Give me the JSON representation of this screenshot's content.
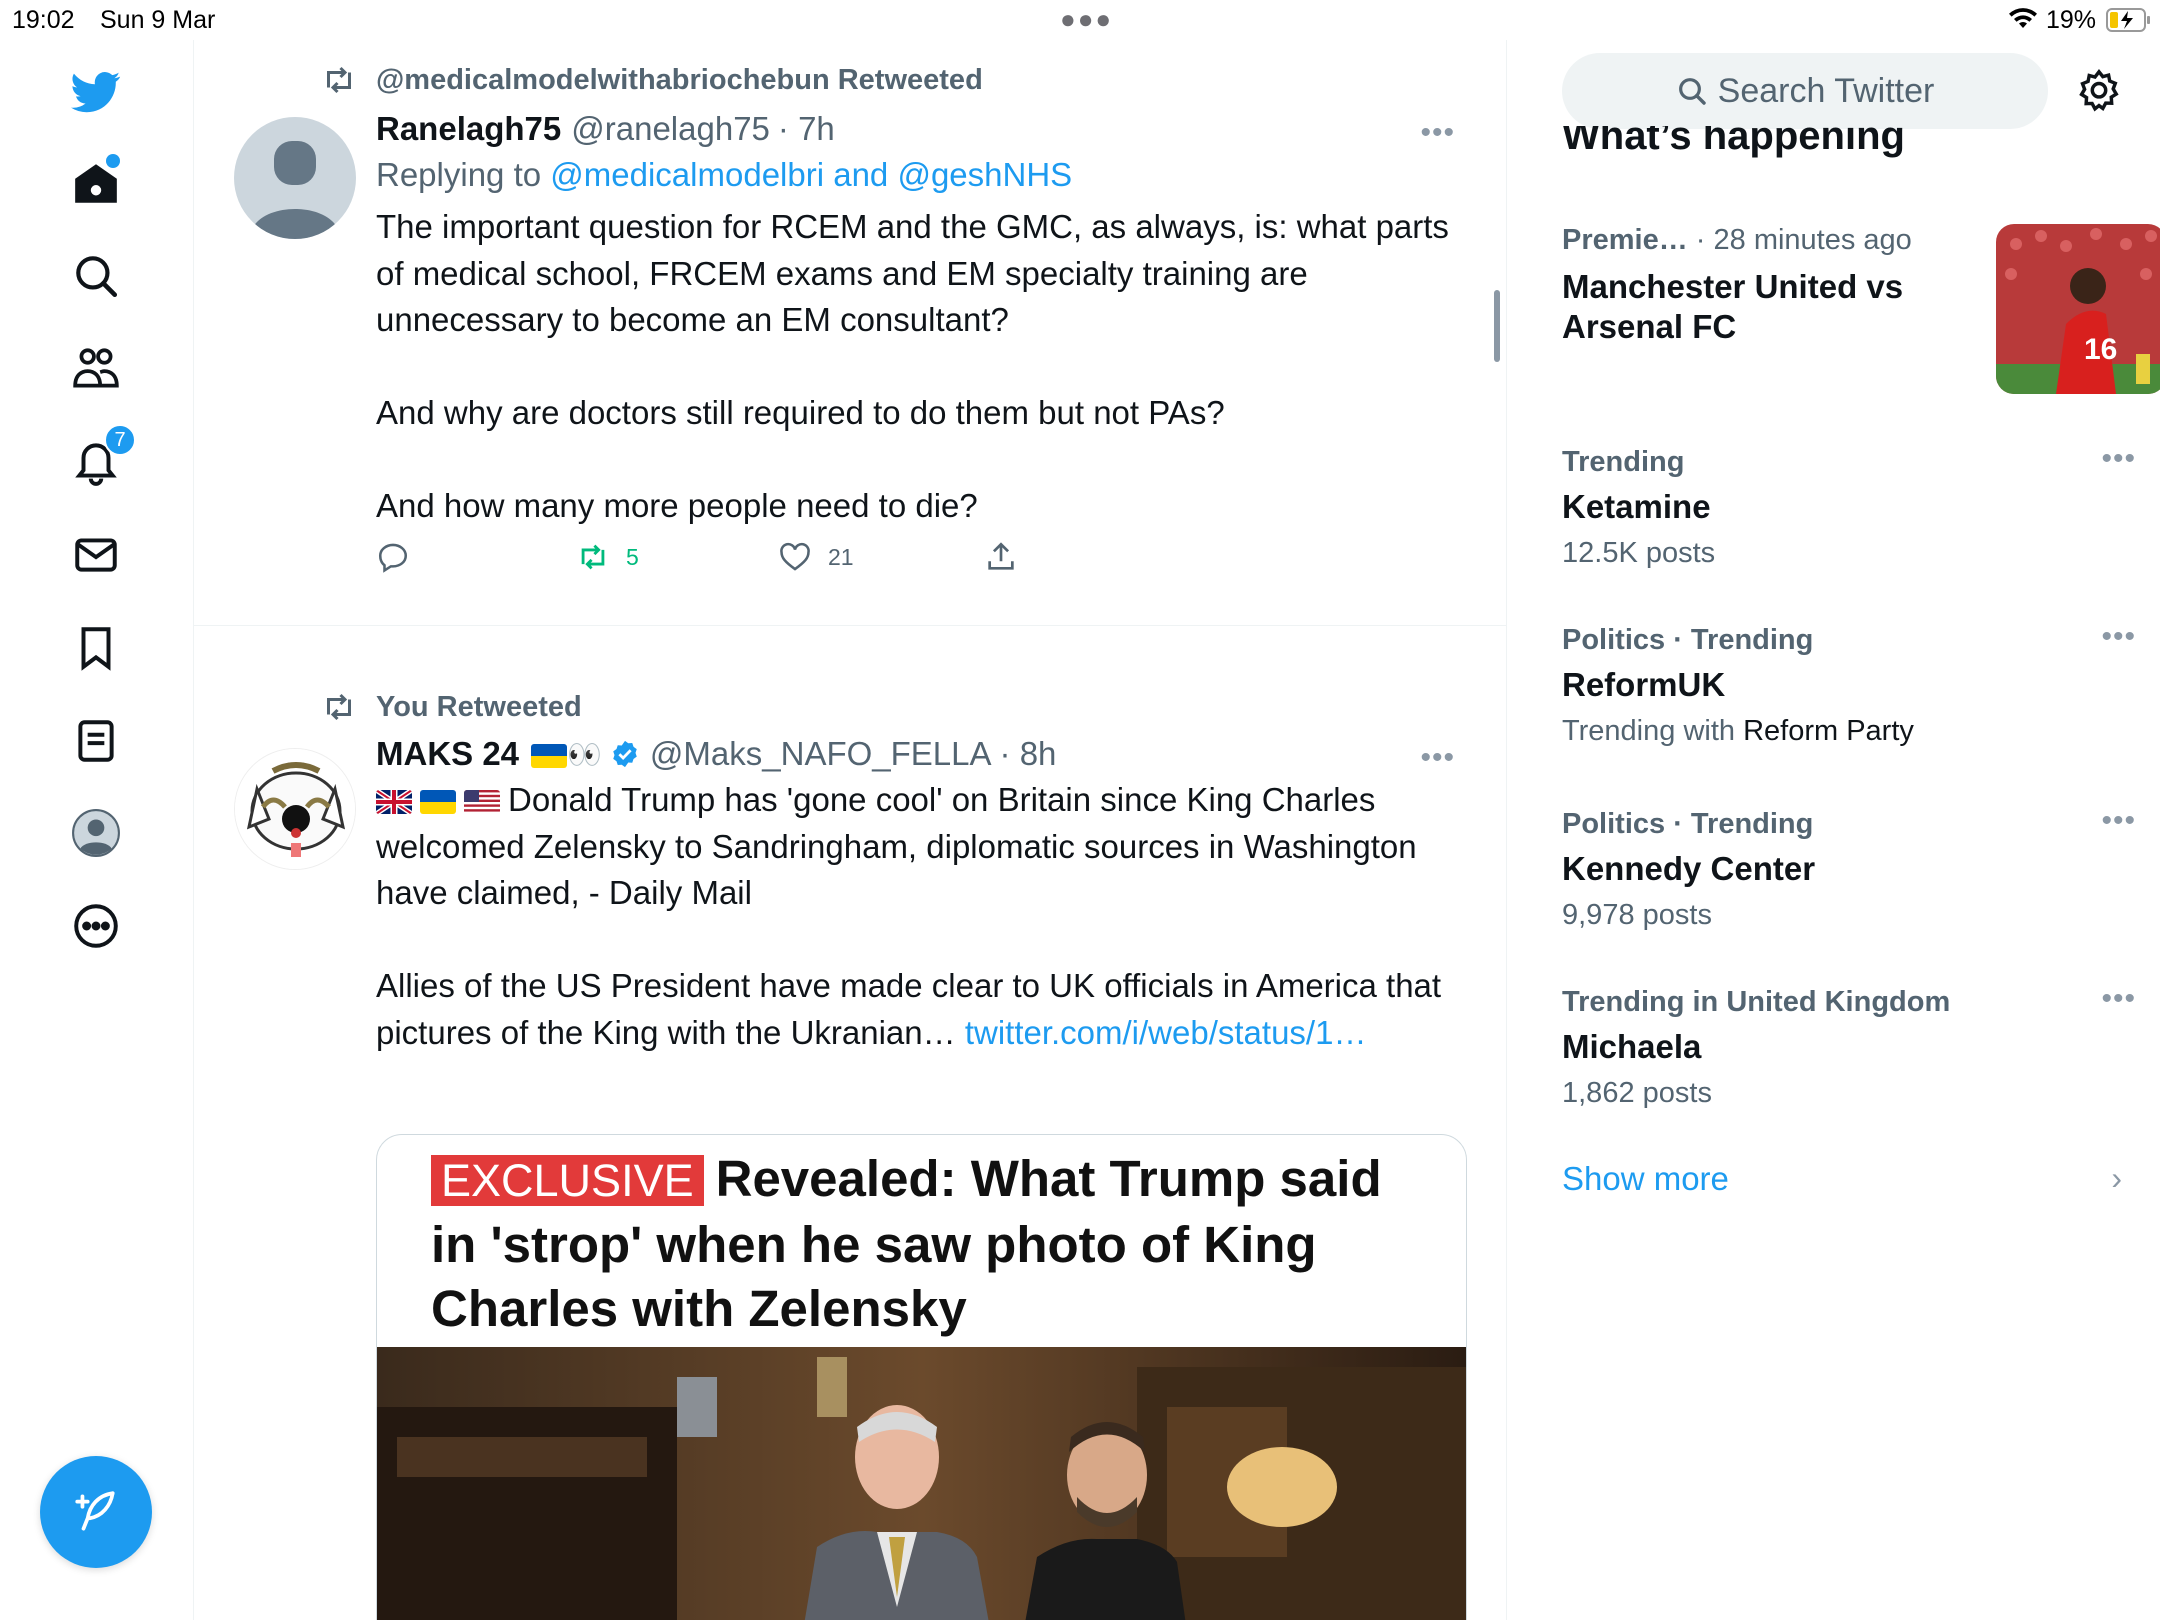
{
  "status_bar": {
    "time": "19:02",
    "date": "Sun 9 Mar",
    "battery": "19%"
  },
  "nav": {
    "notifications_badge": "7",
    "items": [
      "twitter-logo",
      "home-icon",
      "search-icon",
      "communities-icon",
      "notifications-icon",
      "messages-icon",
      "bookmarks-icon",
      "lists-icon",
      "profile-icon",
      "more-icon"
    ]
  },
  "timeline": {
    "tweet1": {
      "retweeted_by": "@medicalmodelwithabriochebun Retweeted",
      "name": "Ranelagh75",
      "handle": "@ranelagh75",
      "time": "· 7h",
      "reply_prefix": "Replying to",
      "reply_to": "@medicalmodelbri and @geshNHS",
      "text": "The important question for RCEM and the GMC, as always, is: what parts of medical school, FRCEM exams and EM specialty training are unnecessary to become an EM consultant?\n\nAnd why are doctors still required to do them but not PAs?\n\nAnd how many more people need to die?",
      "retweets": "5",
      "likes": "21"
    },
    "tweet2": {
      "retweeted_by": "You Retweeted",
      "name": "MAKS 24",
      "name_emoji": "👀",
      "handle": "@Maks_NAFO_FELLA",
      "time": "· 8h",
      "text_line1": "Donald Trump has 'gone cool' on Britain since King Charles welcomed Zelensky to Sandringham, diplomatic sources in Washington have claimed, - Daily Mail",
      "text_para2": "Allies of the US President have made clear to UK officials in America that pictures of the King with the Ukranian…",
      "link": "twitter.com/i/web/status/1…",
      "card_tag": "EXCLUSIVE",
      "card_title": "Revealed: What Trump said in 'strop' when he saw photo of King Charles with Zelensky"
    }
  },
  "sidebar": {
    "search_placeholder": "Search Twitter",
    "heading": "What’s happening",
    "trends": [
      {
        "meta": "Premie…",
        "meta2": "· 28 minutes ago",
        "title": "Manchester United vs Arsenal FC"
      },
      {
        "meta": "Trending",
        "title": "Ketamine",
        "sub": "12.5K posts"
      },
      {
        "meta": "Politics · Trending",
        "title": "ReformUK",
        "sub_prefix": "Trending with",
        "sub_bold": "Reform Party"
      },
      {
        "meta": "Politics · Trending",
        "title": "Kennedy Center",
        "sub": "9,978 posts"
      },
      {
        "meta": "Trending in United Kingdom",
        "title": "Michaela",
        "sub": "1,862 posts"
      }
    ],
    "show_more": "Show more"
  },
  "colors": {
    "accent": "#1d9bf0",
    "retweet_green": "#00ba7c",
    "muted": "#536471",
    "exclusive_red": "#e23a3a"
  }
}
